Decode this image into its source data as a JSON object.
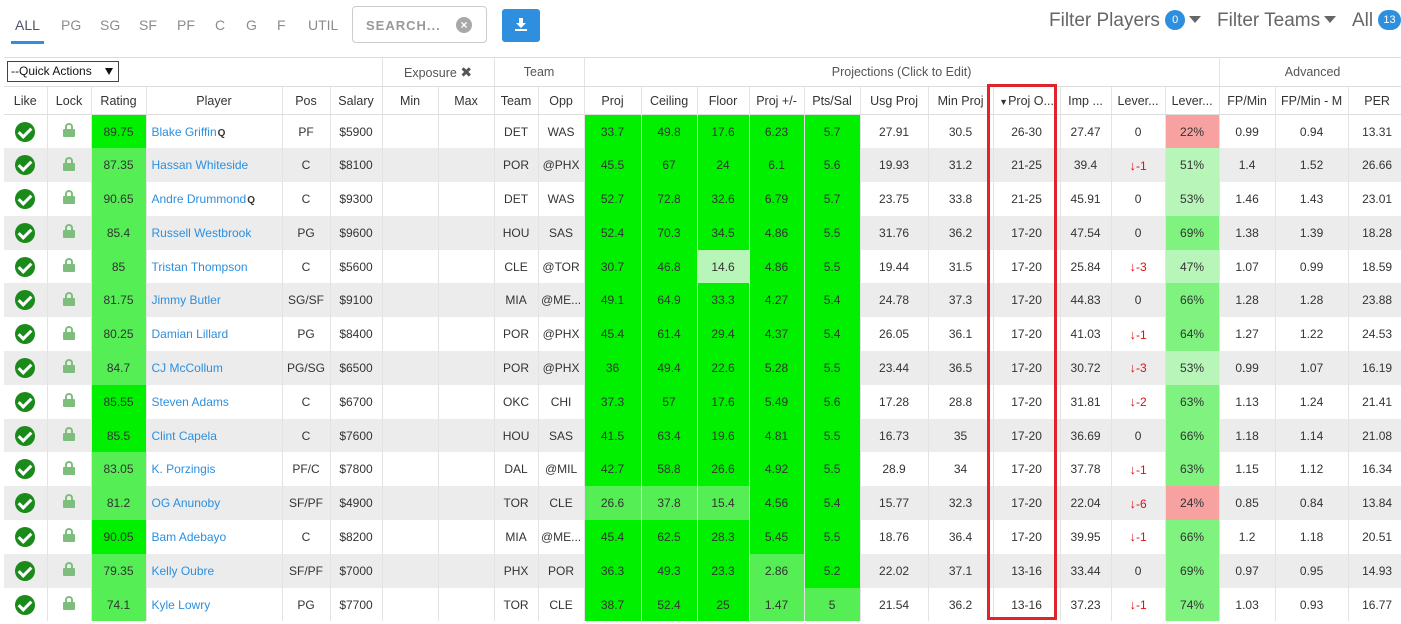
{
  "positions": [
    "ALL",
    "PG",
    "SG",
    "SF",
    "PF",
    "C",
    "G",
    "F",
    "UTIL"
  ],
  "search": {
    "placeholder": "SEARCH..."
  },
  "filters": {
    "players_label": "Filter Players",
    "players_count": "0",
    "teams_label": "Filter Teams",
    "all_label": "All",
    "all_count": "13"
  },
  "quick_actions": "--Quick Actions",
  "groups": {
    "exposure": "Exposure",
    "team": "Team",
    "projections": "Projections (Click to Edit)",
    "advanced": "Advanced"
  },
  "headers": [
    "Like",
    "Lock",
    "Rating",
    "Player",
    "Pos",
    "Salary",
    "Min",
    "Max",
    "Team",
    "Opp",
    "Proj",
    "Ceiling",
    "Floor",
    "Proj +/-",
    "Pts/Sal",
    "Usg Proj",
    "Min Proj",
    "Proj O...",
    "Imp ...",
    "Lever...",
    "Lever...",
    "FP/Min",
    "FP/Min - M",
    "PER"
  ],
  "rows": [
    {
      "rating": "89.75",
      "player": "Blake Griffin",
      "q": "Q",
      "pos": "PF",
      "salary": "$5900",
      "team": "DET",
      "opp": "WAS",
      "proj": "33.7",
      "ceiling": "49.8",
      "floor": "17.6",
      "pm": "6.23",
      "ptssal": "5.7",
      "usg": "27.91",
      "minproj": "30.5",
      "projo": "26-30",
      "imp": "27.47",
      "lev1": "0",
      "lev2": "22%",
      "fpmin": "0.99",
      "fpminm": "0.94",
      "per": "13.31"
    },
    {
      "rating": "87.35",
      "player": "Hassan Whiteside",
      "q": "",
      "pos": "C",
      "salary": "$8100",
      "team": "POR",
      "opp": "@PHX",
      "proj": "45.5",
      "ceiling": "67",
      "floor": "24",
      "pm": "6.1",
      "ptssal": "5.6",
      "usg": "19.93",
      "minproj": "31.2",
      "projo": "21-25",
      "imp": "39.4",
      "lev1": "-1",
      "lev2": "51%",
      "fpmin": "1.4",
      "fpminm": "1.52",
      "per": "26.66"
    },
    {
      "rating": "90.65",
      "player": "Andre Drummond",
      "q": "Q",
      "pos": "C",
      "salary": "$9300",
      "team": "DET",
      "opp": "WAS",
      "proj": "52.7",
      "ceiling": "72.8",
      "floor": "32.6",
      "pm": "6.79",
      "ptssal": "5.7",
      "usg": "23.75",
      "minproj": "33.8",
      "projo": "21-25",
      "imp": "45.91",
      "lev1": "0",
      "lev2": "53%",
      "fpmin": "1.46",
      "fpminm": "1.43",
      "per": "23.01"
    },
    {
      "rating": "85.4",
      "player": "Russell Westbrook",
      "q": "",
      "pos": "PG",
      "salary": "$9600",
      "team": "HOU",
      "opp": "SAS",
      "proj": "52.4",
      "ceiling": "70.3",
      "floor": "34.5",
      "pm": "4.86",
      "ptssal": "5.5",
      "usg": "31.76",
      "minproj": "36.2",
      "projo": "17-20",
      "imp": "47.54",
      "lev1": "0",
      "lev2": "69%",
      "fpmin": "1.38",
      "fpminm": "1.39",
      "per": "18.28"
    },
    {
      "rating": "85",
      "player": "Tristan Thompson",
      "q": "",
      "pos": "C",
      "salary": "$5600",
      "team": "CLE",
      "opp": "@TOR",
      "proj": "30.7",
      "ceiling": "46.8",
      "floor": "14.6",
      "pm": "4.86",
      "ptssal": "5.5",
      "usg": "19.44",
      "minproj": "31.5",
      "projo": "17-20",
      "imp": "25.84",
      "lev1": "-3",
      "lev2": "47%",
      "fpmin": "1.07",
      "fpminm": "0.99",
      "per": "18.59"
    },
    {
      "rating": "81.75",
      "player": "Jimmy Butler",
      "q": "",
      "pos": "SG/SF",
      "salary": "$9100",
      "team": "MIA",
      "opp": "@ME...",
      "proj": "49.1",
      "ceiling": "64.9",
      "floor": "33.3",
      "pm": "4.27",
      "ptssal": "5.4",
      "usg": "24.78",
      "minproj": "37.3",
      "projo": "17-20",
      "imp": "44.83",
      "lev1": "0",
      "lev2": "66%",
      "fpmin": "1.28",
      "fpminm": "1.28",
      "per": "23.88"
    },
    {
      "rating": "80.25",
      "player": "Damian Lillard",
      "q": "",
      "pos": "PG",
      "salary": "$8400",
      "team": "POR",
      "opp": "@PHX",
      "proj": "45.4",
      "ceiling": "61.4",
      "floor": "29.4",
      "pm": "4.37",
      "ptssal": "5.4",
      "usg": "26.05",
      "minproj": "36.1",
      "projo": "17-20",
      "imp": "41.03",
      "lev1": "-1",
      "lev2": "64%",
      "fpmin": "1.27",
      "fpminm": "1.22",
      "per": "24.53"
    },
    {
      "rating": "84.7",
      "player": "CJ McCollum",
      "q": "",
      "pos": "PG/SG",
      "salary": "$6500",
      "team": "POR",
      "opp": "@PHX",
      "proj": "36",
      "ceiling": "49.4",
      "floor": "22.6",
      "pm": "5.28",
      "ptssal": "5.5",
      "usg": "23.44",
      "minproj": "36.5",
      "projo": "17-20",
      "imp": "30.72",
      "lev1": "-3",
      "lev2": "53%",
      "fpmin": "0.99",
      "fpminm": "1.07",
      "per": "16.19"
    },
    {
      "rating": "85.55",
      "player": "Steven Adams",
      "q": "",
      "pos": "C",
      "salary": "$6700",
      "team": "OKC",
      "opp": "CHI",
      "proj": "37.3",
      "ceiling": "57",
      "floor": "17.6",
      "pm": "5.49",
      "ptssal": "5.6",
      "usg": "17.28",
      "minproj": "28.8",
      "projo": "17-20",
      "imp": "31.81",
      "lev1": "-2",
      "lev2": "63%",
      "fpmin": "1.13",
      "fpminm": "1.24",
      "per": "21.41"
    },
    {
      "rating": "85.5",
      "player": "Clint Capela",
      "q": "",
      "pos": "C",
      "salary": "$7600",
      "team": "HOU",
      "opp": "SAS",
      "proj": "41.5",
      "ceiling": "63.4",
      "floor": "19.6",
      "pm": "4.81",
      "ptssal": "5.5",
      "usg": "16.73",
      "minproj": "35",
      "projo": "17-20",
      "imp": "36.69",
      "lev1": "0",
      "lev2": "66%",
      "fpmin": "1.18",
      "fpminm": "1.14",
      "per": "21.08"
    },
    {
      "rating": "83.05",
      "player": "K. Porzingis",
      "q": "",
      "pos": "PF/C",
      "salary": "$7800",
      "team": "DAL",
      "opp": "@MIL",
      "proj": "42.7",
      "ceiling": "58.8",
      "floor": "26.6",
      "pm": "4.92",
      "ptssal": "5.5",
      "usg": "28.9",
      "minproj": "34",
      "projo": "17-20",
      "imp": "37.78",
      "lev1": "-1",
      "lev2": "63%",
      "fpmin": "1.15",
      "fpminm": "1.12",
      "per": "16.34"
    },
    {
      "rating": "81.2",
      "player": "OG Anunoby",
      "q": "",
      "pos": "SF/PF",
      "salary": "$4900",
      "team": "TOR",
      "opp": "CLE",
      "proj": "26.6",
      "ceiling": "37.8",
      "floor": "15.4",
      "pm": "4.56",
      "ptssal": "5.4",
      "usg": "15.77",
      "minproj": "32.3",
      "projo": "17-20",
      "imp": "22.04",
      "lev1": "-6",
      "lev2": "24%",
      "fpmin": "0.85",
      "fpminm": "0.84",
      "per": "13.84"
    },
    {
      "rating": "90.05",
      "player": "Bam Adebayo",
      "q": "",
      "pos": "C",
      "salary": "$8200",
      "team": "MIA",
      "opp": "@ME...",
      "proj": "45.4",
      "ceiling": "62.5",
      "floor": "28.3",
      "pm": "5.45",
      "ptssal": "5.5",
      "usg": "18.76",
      "minproj": "36.4",
      "projo": "17-20",
      "imp": "39.95",
      "lev1": "-1",
      "lev2": "66%",
      "fpmin": "1.2",
      "fpminm": "1.18",
      "per": "20.51"
    },
    {
      "rating": "79.35",
      "player": "Kelly Oubre",
      "q": "",
      "pos": "SF/PF",
      "salary": "$7000",
      "team": "PHX",
      "opp": "POR",
      "proj": "36.3",
      "ceiling": "49.3",
      "floor": "23.3",
      "pm": "2.86",
      "ptssal": "5.2",
      "usg": "22.02",
      "minproj": "37.1",
      "projo": "13-16",
      "imp": "33.44",
      "lev1": "0",
      "lev2": "69%",
      "fpmin": "0.97",
      "fpminm": "0.95",
      "per": "14.93"
    },
    {
      "rating": "74.1",
      "player": "Kyle Lowry",
      "q": "",
      "pos": "PG",
      "salary": "$7700",
      "team": "TOR",
      "opp": "CLE",
      "proj": "38.7",
      "ceiling": "52.4",
      "floor": "25",
      "pm": "1.47",
      "ptssal": "5",
      "usg": "21.54",
      "minproj": "36.2",
      "projo": "13-16",
      "imp": "37.23",
      "lev1": "-1",
      "lev2": "74%",
      "fpmin": "1.03",
      "fpminm": "0.93",
      "per": "16.77"
    }
  ]
}
